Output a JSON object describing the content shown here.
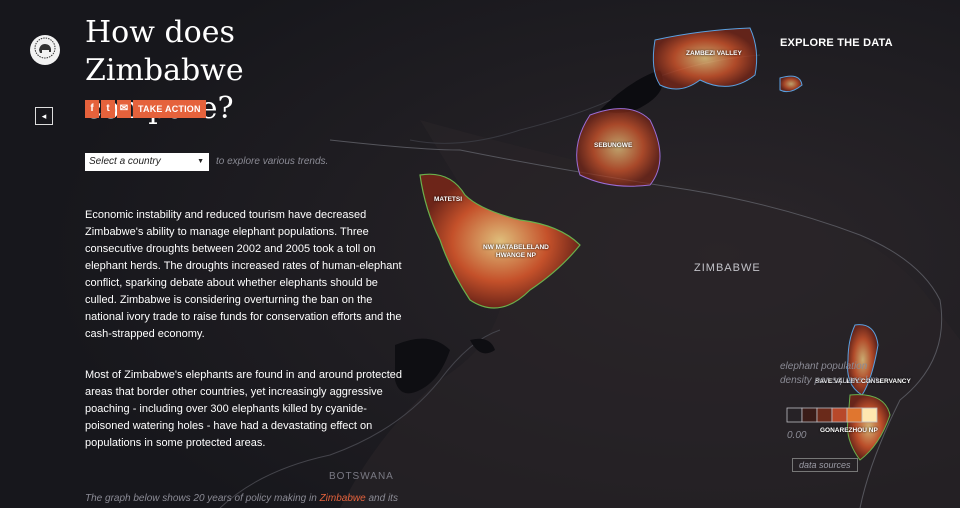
{
  "header": {
    "title_line1": "How does Zimbabwe",
    "title_line2": "compare?"
  },
  "share": {
    "facebook_glyph": "f",
    "twitter_glyph": "t",
    "email_glyph": "✉",
    "take_action_label": "TAKE ACTION"
  },
  "filter": {
    "select_value": "Select a country",
    "hint": "to explore various trends."
  },
  "paragraphs": [
    [
      "Economic instability and reduced tourism have decreased",
      "Zimbabwe's ability to manage elephant populations. Three",
      "consecutive droughts between 2002 and 2005 took a toll on",
      "elephant herds. The droughts increased rates of human-elephant",
      "conflict, sparking debate about whether elephants should be",
      "culled. Zimbabwe is considering overturning the ban on the",
      "national ivory trade to raise funds for conservation efforts and the",
      "cash-strapped economy."
    ],
    [
      "Most of Zimbabwe's elephants are found in and around protected",
      "areas that border other countries, yet increasingly aggressive",
      "poaching - including over 300 elephants killed by cyanide-",
      "poisoned watering holes - have had a devastating effect on",
      "populations in some protected areas."
    ]
  ],
  "caption": {
    "before": "The graph below shows 20 years of policy making in ",
    "highlight": "Zimbabwe",
    "after": " and its"
  },
  "map": {
    "explore_label": "EXPLORE THE DATA",
    "country_label": "ZIMBABWE",
    "neighbor_label": "BOTSWANA",
    "areas": {
      "zambezi_valley": "ZAMBEZI VALLEY",
      "sebungwe": "SEBUNGWE",
      "matetsi": "MATETSI",
      "nw_matabeleland_line1": "NW MATABELELAND",
      "nw_matabeleland_line2": "HWANGE NP",
      "save_valley": "SAVE VALLEY CONSERVANCY",
      "gonarezhou": "GONAREZHOU NP"
    }
  },
  "legend": {
    "title_line1": "elephant population",
    "title_line2": "density per square km.",
    "min_label": "0.00",
    "data_sources_label": "data sources"
  },
  "colors": {
    "accent": "#e5623c",
    "background": "#1c1c22",
    "muted_text": "#8b8b95"
  },
  "icons": {
    "logo": "elephant-logo-icon",
    "back": "chevron-left-icon",
    "select_chevron": "chevron-down-icon"
  }
}
